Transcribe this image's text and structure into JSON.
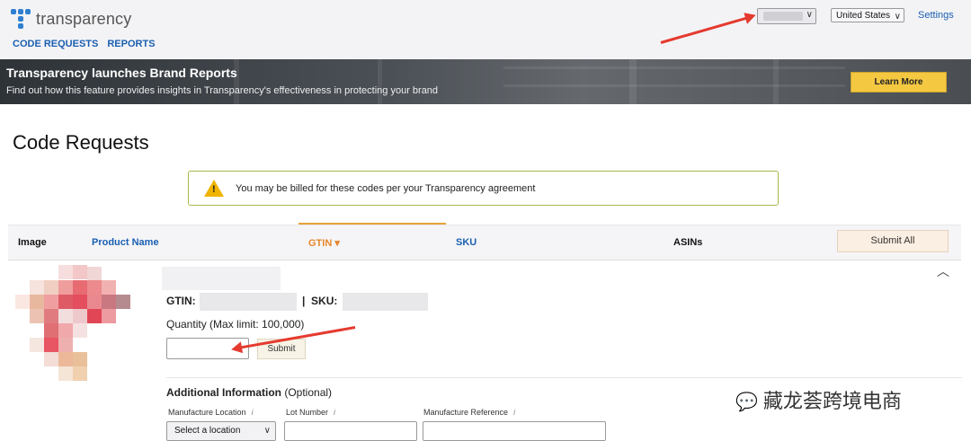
{
  "header": {
    "brand": "transparency",
    "nav": [
      "CODE REQUESTS",
      "REPORTS"
    ],
    "account_select": "",
    "country_select": "United States",
    "settings": "Settings"
  },
  "banner": {
    "title": "Transparency launches Brand Reports",
    "subtitle": "Find out how this feature provides insights in Transparency's effectiveness in protecting your brand",
    "button": "Learn More"
  },
  "page": {
    "title": "Code Requests",
    "alert": "You may be billed for these codes per your Transparency agreement"
  },
  "table": {
    "headers": {
      "image": "Image",
      "product_name": "Product Name",
      "gtin": "GTIN",
      "gtin_sort_icon": "▾",
      "sku": "SKU",
      "asins": "ASINs"
    },
    "submit_all": "Submit All",
    "row": {
      "gtin_label": "GTIN:",
      "sku_sep": "|",
      "sku_label": "SKU:",
      "quantity_label": "Quantity",
      "quantity_hint": "(Max limit: 100,000)",
      "submit": "Submit",
      "additional_info": "Additional Information",
      "optional": "(Optional)",
      "manufacture_location": "Manufacture Location",
      "lot_number": "Lot Number",
      "manufacture_reference": "Manufacture Reference",
      "select_location": "Select a location",
      "info_mark": "i"
    }
  },
  "watermark": "藏龙荟跨境电商",
  "colors": {
    "accent_blue": "#1a5fb0",
    "learn_more": "#f5c842",
    "arrow": "#e53a2f"
  }
}
